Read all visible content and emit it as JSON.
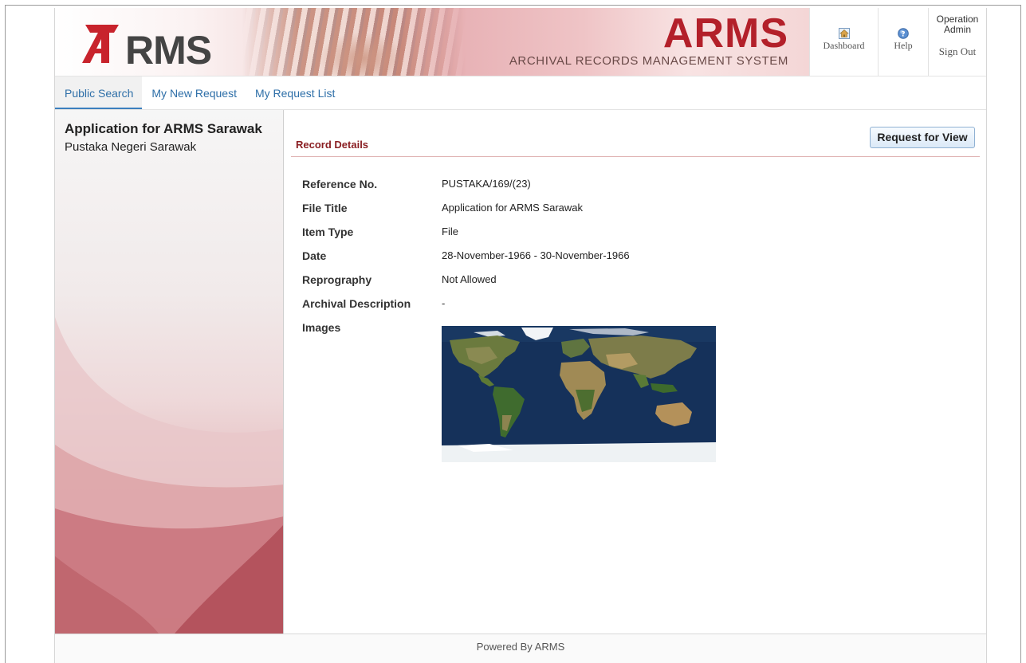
{
  "header": {
    "logo_text": "RMS",
    "banner_title": "ARMS",
    "banner_subtitle": "ARCHIVAL RECORDS MANAGEMENT SYSTEM",
    "dashboard_label": "Dashboard",
    "help_label": "Help",
    "user_line1": "Operation",
    "user_line2": "Admin",
    "signout_label": "Sign Out"
  },
  "nav": {
    "tabs": [
      {
        "label": "Public Search",
        "active": true
      },
      {
        "label": "My New Request",
        "active": false
      },
      {
        "label": "My Request List",
        "active": false
      }
    ]
  },
  "sidebar": {
    "title": "Application for ARMS Sarawak",
    "subtitle": "Pustaka Negeri Sarawak"
  },
  "main": {
    "section_title": "Record Details",
    "request_button": "Request for View",
    "fields": [
      {
        "label": "Reference No.",
        "value": "PUSTAKA/169/(23)"
      },
      {
        "label": "File Title",
        "value": "Application for ARMS Sarawak"
      },
      {
        "label": "Item Type",
        "value": "File"
      },
      {
        "label": "Date",
        "value": "28-November-1966 - 30-November-1966"
      },
      {
        "label": "Reprography",
        "value": "Not Allowed"
      },
      {
        "label": "Archival Description",
        "value": "-"
      },
      {
        "label": "Images",
        "value": ""
      }
    ]
  },
  "footer": {
    "text": "Powered By ARMS"
  },
  "icons": {
    "logo": "arms-logo-icon",
    "dashboard": "home-icon",
    "help": "help-icon"
  },
  "colors": {
    "brand_red": "#b3202a",
    "link_blue": "#2e6fa8",
    "section_title": "#8a1e22"
  }
}
